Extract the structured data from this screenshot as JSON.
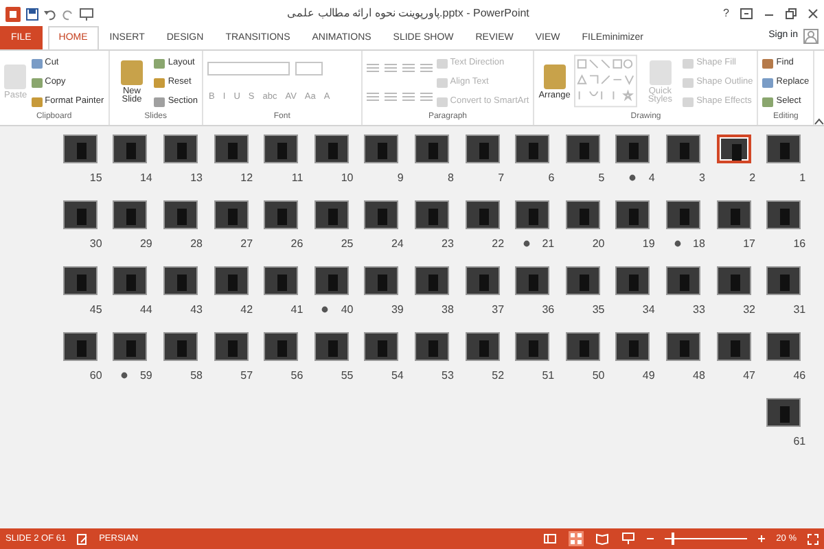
{
  "window": {
    "title": "پاورپوینت نحوه ارائه مطالب علمی.pptx - PowerPoint",
    "help": "?"
  },
  "tabs": [
    {
      "label": "FILE",
      "kind": "file",
      "selected": false
    },
    {
      "label": "HOME",
      "kind": "tab",
      "selected": true
    },
    {
      "label": "INSERT",
      "kind": "tab",
      "selected": false
    },
    {
      "label": "DESIGN",
      "kind": "tab",
      "selected": false
    },
    {
      "label": "TRANSITIONS",
      "kind": "tab",
      "selected": false
    },
    {
      "label": "ANIMATIONS",
      "kind": "tab",
      "selected": false
    },
    {
      "label": "SLIDE SHOW",
      "kind": "tab",
      "selected": false
    },
    {
      "label": "REVIEW",
      "kind": "tab",
      "selected": false
    },
    {
      "label": "VIEW",
      "kind": "tab",
      "selected": false
    },
    {
      "label": "FILEminimizer",
      "kind": "tab",
      "selected": false
    }
  ],
  "account": {
    "label": "Sign in"
  },
  "ribbon": {
    "groups": [
      {
        "label": "Clipboard",
        "kind": "clipboard",
        "big": {
          "label": "Paste",
          "disabled": true
        },
        "items": [
          {
            "label": "Cut",
            "disabled": false
          },
          {
            "label": "Copy",
            "disabled": false
          },
          {
            "label": "Format Painter",
            "disabled": false
          }
        ]
      },
      {
        "label": "Slides",
        "kind": "slides",
        "big": {
          "label": "New Slide",
          "disabled": false
        },
        "items": [
          {
            "label": "Layout",
            "disabled": false
          },
          {
            "label": "Reset",
            "disabled": false
          },
          {
            "label": "Section",
            "disabled": false
          }
        ]
      },
      {
        "label": "Font",
        "kind": "font",
        "buttons": [
          "B",
          "I",
          "U",
          "S",
          "abc",
          "AV",
          "Aa",
          "A"
        ]
      },
      {
        "label": "Paragraph",
        "kind": "paragraph",
        "items": [
          {
            "label": "Text Direction",
            "disabled": true
          },
          {
            "label": "Align Text",
            "disabled": true
          },
          {
            "label": "Convert to SmartArt",
            "disabled": true
          }
        ]
      },
      {
        "label": "Drawing",
        "kind": "drawing",
        "big": {
          "label": "Arrange",
          "disabled": false
        },
        "big2": {
          "label": "Quick Styles",
          "disabled": true
        },
        "items": [
          {
            "label": "Shape Fill",
            "disabled": true
          },
          {
            "label": "Shape Outline",
            "disabled": true
          },
          {
            "label": "Shape Effects",
            "disabled": true
          }
        ]
      },
      {
        "label": "Editing",
        "kind": "editing",
        "items": [
          {
            "label": "Find",
            "disabled": false
          },
          {
            "label": "Replace",
            "disabled": false
          },
          {
            "label": "Select",
            "disabled": false
          }
        ]
      }
    ]
  },
  "slides": [
    {
      "number": "15",
      "selected": false,
      "animated": false
    },
    {
      "number": "14",
      "selected": false,
      "animated": false
    },
    {
      "number": "13",
      "selected": false,
      "animated": false
    },
    {
      "number": "12",
      "selected": false,
      "animated": false
    },
    {
      "number": "11",
      "selected": false,
      "animated": false
    },
    {
      "number": "10",
      "selected": false,
      "animated": false
    },
    {
      "number": "9",
      "selected": false,
      "animated": false
    },
    {
      "number": "8",
      "selected": false,
      "animated": false
    },
    {
      "number": "7",
      "selected": false,
      "animated": false
    },
    {
      "number": "6",
      "selected": false,
      "animated": false
    },
    {
      "number": "5",
      "selected": false,
      "animated": false
    },
    {
      "number": "4",
      "selected": false,
      "animated": true
    },
    {
      "number": "3",
      "selected": false,
      "animated": false
    },
    {
      "number": "2",
      "selected": true,
      "animated": false
    },
    {
      "number": "1",
      "selected": false,
      "animated": false
    },
    {
      "number": "30",
      "selected": false,
      "animated": false
    },
    {
      "number": "29",
      "selected": false,
      "animated": false
    },
    {
      "number": "28",
      "selected": false,
      "animated": false
    },
    {
      "number": "27",
      "selected": false,
      "animated": false
    },
    {
      "number": "26",
      "selected": false,
      "animated": false
    },
    {
      "number": "25",
      "selected": false,
      "animated": false
    },
    {
      "number": "24",
      "selected": false,
      "animated": false
    },
    {
      "number": "23",
      "selected": false,
      "animated": false
    },
    {
      "number": "22",
      "selected": false,
      "animated": false
    },
    {
      "number": "21",
      "selected": false,
      "animated": true
    },
    {
      "number": "20",
      "selected": false,
      "animated": false
    },
    {
      "number": "19",
      "selected": false,
      "animated": false
    },
    {
      "number": "18",
      "selected": false,
      "animated": true
    },
    {
      "number": "17",
      "selected": false,
      "animated": false
    },
    {
      "number": "16",
      "selected": false,
      "animated": false
    },
    {
      "number": "45",
      "selected": false,
      "animated": false
    },
    {
      "number": "44",
      "selected": false,
      "animated": false
    },
    {
      "number": "43",
      "selected": false,
      "animated": false
    },
    {
      "number": "42",
      "selected": false,
      "animated": false
    },
    {
      "number": "41",
      "selected": false,
      "animated": false
    },
    {
      "number": "40",
      "selected": false,
      "animated": true
    },
    {
      "number": "39",
      "selected": false,
      "animated": false
    },
    {
      "number": "38",
      "selected": false,
      "animated": false
    },
    {
      "number": "37",
      "selected": false,
      "animated": false
    },
    {
      "number": "36",
      "selected": false,
      "animated": false
    },
    {
      "number": "35",
      "selected": false,
      "animated": false
    },
    {
      "number": "34",
      "selected": false,
      "animated": false
    },
    {
      "number": "33",
      "selected": false,
      "animated": false
    },
    {
      "number": "32",
      "selected": false,
      "animated": false
    },
    {
      "number": "31",
      "selected": false,
      "animated": false
    },
    {
      "number": "60",
      "selected": false,
      "animated": false
    },
    {
      "number": "59",
      "selected": false,
      "animated": true
    },
    {
      "number": "58",
      "selected": false,
      "animated": false
    },
    {
      "number": "57",
      "selected": false,
      "animated": false
    },
    {
      "number": "56",
      "selected": false,
      "animated": false
    },
    {
      "number": "55",
      "selected": false,
      "animated": false
    },
    {
      "number": "54",
      "selected": false,
      "animated": false
    },
    {
      "number": "53",
      "selected": false,
      "animated": false
    },
    {
      "number": "52",
      "selected": false,
      "animated": false
    },
    {
      "number": "51",
      "selected": false,
      "animated": false
    },
    {
      "number": "50",
      "selected": false,
      "animated": false
    },
    {
      "number": "49",
      "selected": false,
      "animated": false
    },
    {
      "number": "48",
      "selected": false,
      "animated": false
    },
    {
      "number": "47",
      "selected": false,
      "animated": false
    },
    {
      "number": "46",
      "selected": false,
      "animated": false
    },
    {
      "number": "61",
      "selected": false,
      "animated": false
    }
  ],
  "status_bar": {
    "slide": "SLIDE 2 OF 61",
    "language": "PERSIAN",
    "views": [
      {
        "kind": "normal",
        "selected": false
      },
      {
        "kind": "sorter",
        "selected": true
      },
      {
        "kind": "reading",
        "selected": false
      },
      {
        "kind": "slideshow",
        "selected": false
      }
    ],
    "zoom": {
      "level": 0.08,
      "reading": "20 %"
    }
  }
}
